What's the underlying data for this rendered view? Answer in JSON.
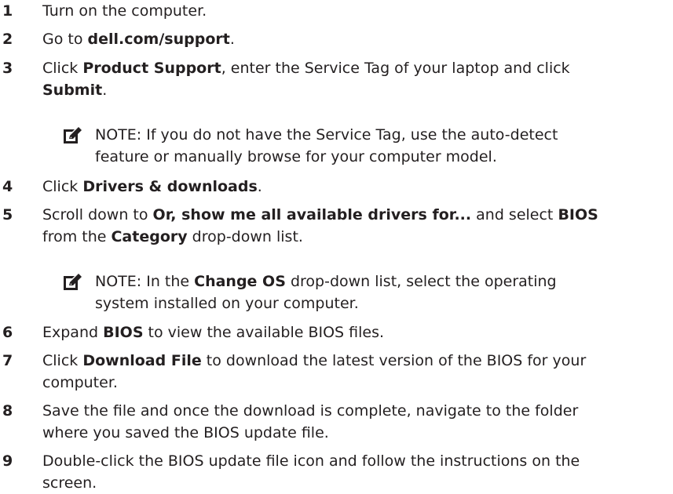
{
  "steps": [
    {
      "num": "1",
      "segments": [
        {
          "t": "Turn on the computer."
        }
      ]
    },
    {
      "num": "2",
      "segments": [
        {
          "t": "Go to "
        },
        {
          "t": "dell.com/support",
          "b": true
        },
        {
          "t": "."
        }
      ]
    },
    {
      "num": "3",
      "lines": [
        [
          {
            "t": "Click "
          },
          {
            "t": "Product Support",
            "b": true
          },
          {
            "t": ", enter the Service Tag of your laptop and click"
          }
        ],
        [
          {
            "t": "Submit",
            "b": true
          },
          {
            "t": "."
          }
        ]
      ]
    },
    {
      "num": "4",
      "segments": [
        {
          "t": "Click "
        },
        {
          "t": "Drivers & downloads",
          "b": true
        },
        {
          "t": "."
        }
      ]
    },
    {
      "num": "5",
      "lines": [
        [
          {
            "t": "Scroll down to "
          },
          {
            "t": "Or, show me all available drivers for...",
            "b": true
          },
          {
            "t": " and select "
          },
          {
            "t": "BIOS",
            "b": true
          }
        ],
        [
          {
            "t": "from the "
          },
          {
            "t": "Category",
            "b": true
          },
          {
            "t": " drop-down list."
          }
        ]
      ]
    },
    {
      "num": "6",
      "segments": [
        {
          "t": "Expand "
        },
        {
          "t": "BIOS",
          "b": true
        },
        {
          "t": " to view the available BIOS files."
        }
      ]
    },
    {
      "num": "7",
      "lines": [
        [
          {
            "t": "Click "
          },
          {
            "t": "Download File",
            "b": true
          },
          {
            "t": " to download the latest version of the BIOS for your"
          }
        ],
        [
          {
            "t": "computer."
          }
        ]
      ]
    },
    {
      "num": "8",
      "lines": [
        [
          {
            "t": "Save the file and once the download is complete, navigate to the folder"
          }
        ],
        [
          {
            "t": "where you saved the BIOS update file."
          }
        ]
      ]
    },
    {
      "num": "9",
      "lines": [
        [
          {
            "t": "Double-click the BIOS update file icon and follow the instructions on the"
          }
        ],
        [
          {
            "t": "screen."
          }
        ]
      ]
    }
  ],
  "notes": [
    {
      "icon": "note-pencil-icon",
      "lines": [
        [
          {
            "t": "NOTE:"
          },
          {
            "t": " If you do not have the Service Tag, use the auto-detect"
          }
        ],
        [
          {
            "t": "feature or manually browse for your computer model."
          }
        ]
      ]
    },
    {
      "icon": "note-pencil-icon",
      "lines": [
        [
          {
            "t": "NOTE:"
          },
          {
            "t": " In the "
          },
          {
            "t": "Change OS",
            "b": true
          },
          {
            "t": " drop-down list, select the operating"
          }
        ],
        [
          {
            "t": "system installed on your computer."
          }
        ]
      ]
    }
  ]
}
